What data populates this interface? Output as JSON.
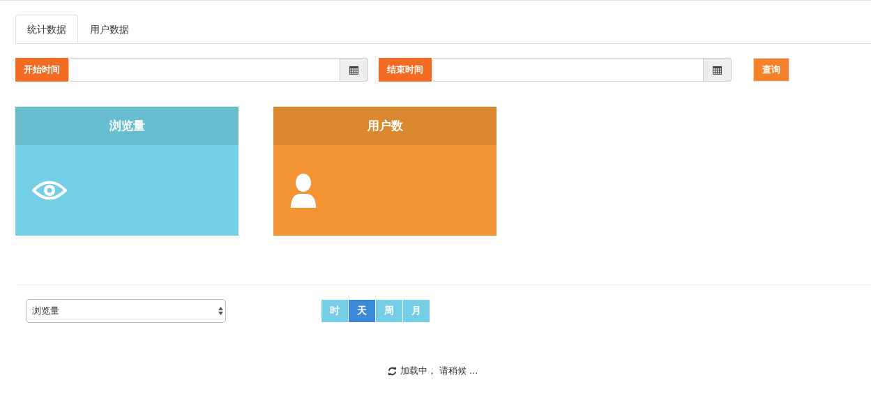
{
  "tabs": [
    {
      "label": "统计数据",
      "selected": true
    },
    {
      "label": "用户数据",
      "selected": false
    }
  ],
  "filters": {
    "start_label": "开始时间",
    "end_label": "结束时间",
    "query_button": "查询"
  },
  "cards": [
    {
      "title": "浏览量",
      "kind": "eye",
      "color": "#74cfe6"
    },
    {
      "title": "用户数",
      "kind": "user",
      "color": "#f29334"
    }
  ],
  "metric_select": {
    "value": "浏览量"
  },
  "periods": [
    {
      "label": "时",
      "selected": false
    },
    {
      "label": "天",
      "selected": true
    },
    {
      "label": "周",
      "selected": false
    },
    {
      "label": "月",
      "selected": false
    }
  ],
  "loading": "加载中， 请稍候 ..."
}
